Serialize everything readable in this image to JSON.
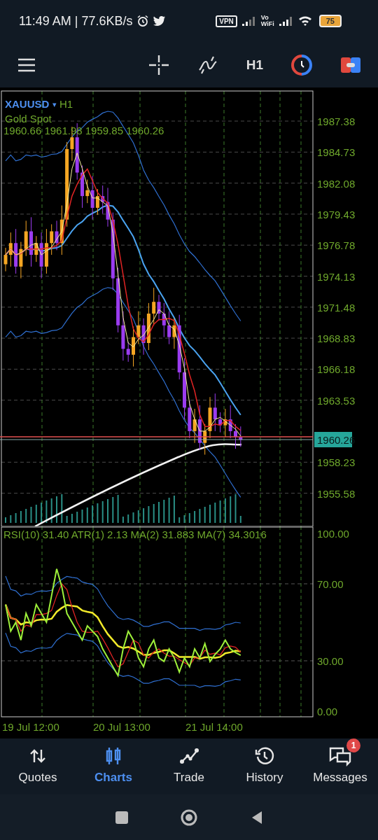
{
  "status_bar": {
    "time": "11:49 AM | 77.6KB/s",
    "vpn": "VPN",
    "vowifi_top": "Vo",
    "vowifi_bottom": "WiFi",
    "battery": "75"
  },
  "toolbar": {
    "timeframe": "H1"
  },
  "chart": {
    "symbol": "XAUUSD",
    "dropdown": "▾",
    "timeframe": "H1",
    "description": "Gold Spot",
    "ohlc": "1960.66 1961.98 1959.85 1960.26",
    "price_ticks": [
      "1987.38",
      "1984.73",
      "1982.08",
      "1979.43",
      "1976.78",
      "1974.13",
      "1971.48",
      "1968.83",
      "1966.18",
      "1963.53",
      "1958.23",
      "1955.58"
    ],
    "current_price": "1960.26"
  },
  "indicator": {
    "legend": "RSI(10) 31.40 ATR(1) 2.13 MA(2) 31.883 MA(7) 34.3016",
    "ticks": [
      "100.00",
      "70.00",
      "30.00",
      "0.00"
    ]
  },
  "time_axis": [
    "19 Jul 12:00",
    "20 Jul 13:00",
    "21 Jul 14:00"
  ],
  "nav": [
    {
      "label": "Quotes",
      "kind": "quotes",
      "selected": false
    },
    {
      "label": "Charts",
      "kind": "charts",
      "selected": true
    },
    {
      "label": "Trade",
      "kind": "trade",
      "selected": false
    },
    {
      "label": "History",
      "kind": "history",
      "selected": false
    },
    {
      "label": "Messages",
      "kind": "messages",
      "selected": false,
      "badge": "1"
    }
  ]
}
